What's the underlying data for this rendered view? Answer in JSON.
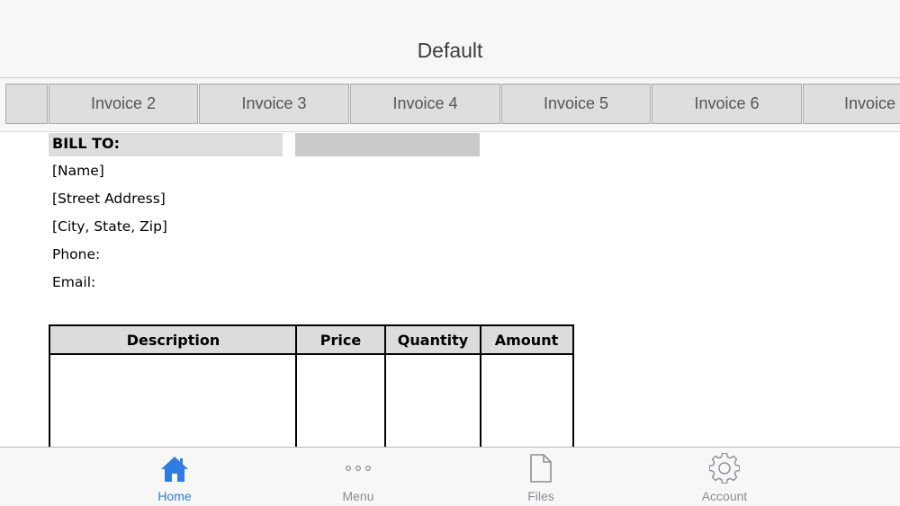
{
  "nav": {
    "title": "Default"
  },
  "tabs": [
    "",
    "Invoice 2",
    "Invoice 3",
    "Invoice 4",
    "Invoice 5",
    "Invoice 6",
    "Invoice"
  ],
  "bill_to": {
    "heading": "BILL TO:",
    "lines": [
      "[Name]",
      "[Street Address]",
      "[City, State,  Zip]",
      "Phone:",
      "Email:"
    ]
  },
  "table": {
    "headers": [
      "Description",
      "Price",
      "Quantity",
      "Amount"
    ]
  },
  "tab_bar": {
    "items": [
      {
        "label": "Home",
        "icon": "home-icon",
        "active": true
      },
      {
        "label": "Menu",
        "icon": "more-icon",
        "active": false
      },
      {
        "label": "Files",
        "icon": "document-icon",
        "active": false
      },
      {
        "label": "Account",
        "icon": "gear-icon",
        "active": false
      }
    ],
    "active_color": "#2f7de1",
    "inactive_color": "#8e8e93"
  }
}
